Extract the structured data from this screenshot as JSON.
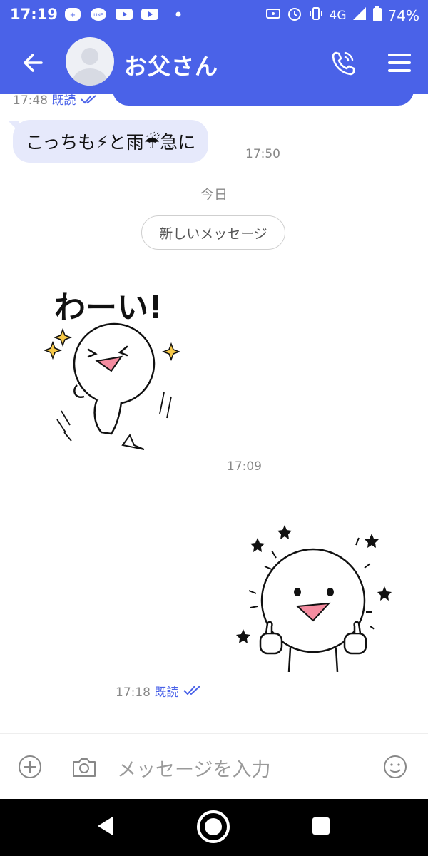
{
  "status_bar": {
    "time": "17:19",
    "network": "4G",
    "battery": "74%"
  },
  "header": {
    "title": "お父さん",
    "accent": "#4a62e8"
  },
  "chat": {
    "previous": {
      "time": "17:48",
      "read": "既読"
    },
    "incoming": {
      "text": "こっちも⚡と雨☔急に",
      "time": "17:50"
    },
    "date_separator": "今日",
    "new_messages": "新しいメッセージ",
    "sticker1": {
      "text": "わーい!",
      "time": "17:09"
    },
    "sticker2": {
      "time": "17:18",
      "read": "既読"
    }
  },
  "input": {
    "placeholder": "メッセージを入力"
  },
  "icons": [
    "back-arrow-icon",
    "phone-icon",
    "menu-icon",
    "plus-icon",
    "camera-icon",
    "emoji-icon"
  ]
}
